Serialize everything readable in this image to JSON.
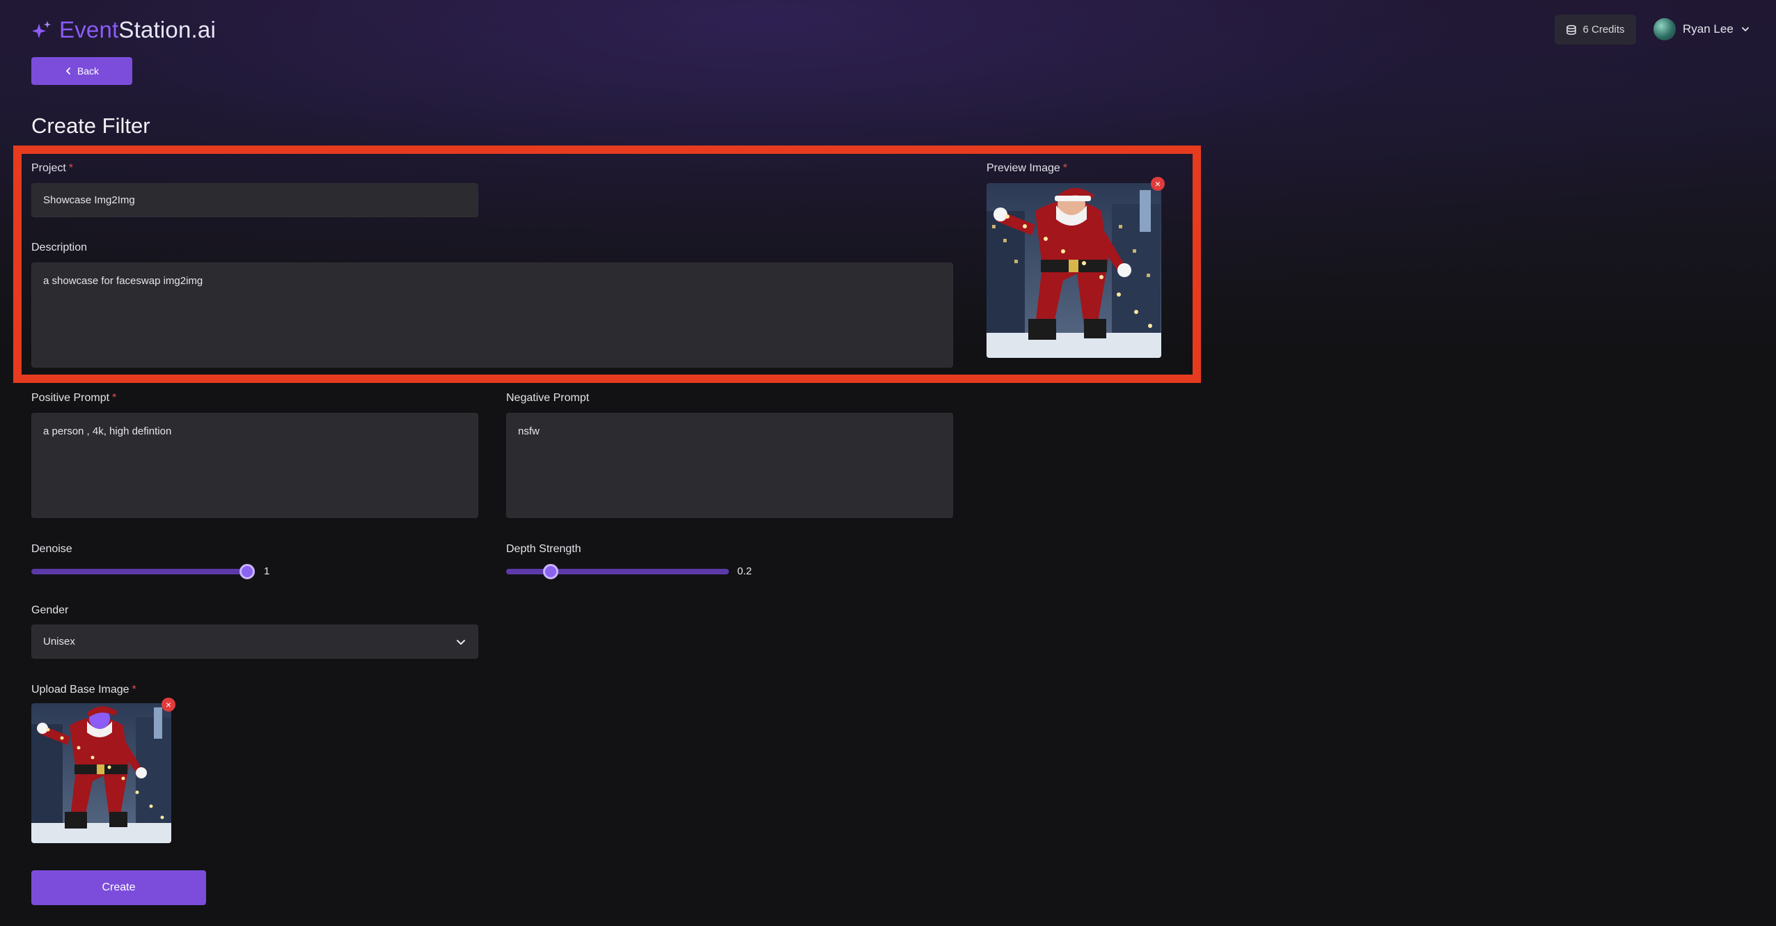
{
  "header": {
    "brand_accent": "Event",
    "brand_rest": "Station.ai",
    "credits_label": "6 Credits",
    "user_name": "Ryan Lee"
  },
  "back_label": "Back",
  "page_title": "Create Filter",
  "form": {
    "project": {
      "label": "Project",
      "value": "Showcase Img2Img"
    },
    "description": {
      "label": "Description",
      "value": "a showcase for faceswap img2img"
    },
    "preview_image": {
      "label": "Preview Image"
    },
    "positive_prompt": {
      "label": "Positive Prompt",
      "value": "a person , 4k, high defintion"
    },
    "negative_prompt": {
      "label": "Negative Prompt",
      "value": "nsfw"
    },
    "denoise": {
      "label": "Denoise",
      "value_text": "1",
      "fraction": 0.97
    },
    "depth_strength": {
      "label": "Depth Strength",
      "value_text": "0.2",
      "fraction": 0.2
    },
    "gender": {
      "label": "Gender",
      "value": "Unisex"
    },
    "upload_base_image": {
      "label": "Upload Base Image"
    },
    "required_mark": "*",
    "remove_glyph": "×"
  },
  "create_label": "Create",
  "colors": {
    "accent": "#7c4ddb",
    "highlight": "#e63b1f",
    "required": "#e0504a",
    "remove": "#e23b3b"
  }
}
